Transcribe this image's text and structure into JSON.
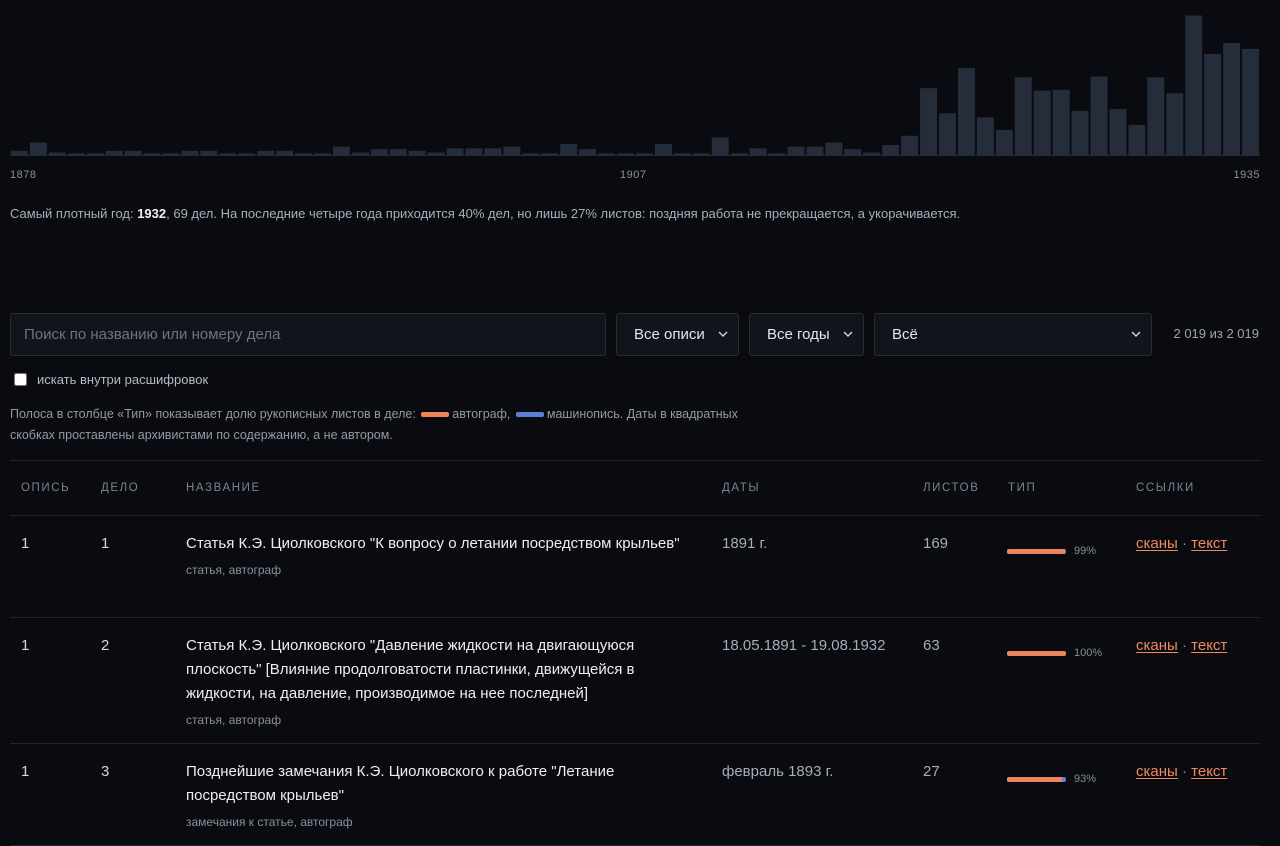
{
  "histogram": {
    "start_label": "1878",
    "mid_label": "1907",
    "end_label": "1935",
    "bar_color": "#262d3a",
    "chart_data": {
      "type": "bar",
      "x_start": 1878,
      "x_end": 1935,
      "values": [
        0.5,
        1.5,
        0.3,
        0.2,
        0.2,
        0.5,
        0.5,
        0.2,
        0.2,
        0.5,
        0.5,
        0.2,
        0.2,
        0.5,
        0.5,
        0.2,
        0.2,
        1,
        0.3,
        0.7,
        0.7,
        0.5,
        0.3,
        0.8,
        0.8,
        0.8,
        1,
        0.2,
        0.2,
        1.3,
        0.7,
        0.2,
        0.2,
        0.2,
        1.3,
        0.2,
        0.2,
        2.1,
        0.2,
        0.8,
        0.2,
        1,
        1,
        1.5,
        0.7,
        0.3,
        1.2,
        2.3,
        8,
        5,
        10.4,
        4.5,
        3,
        9.3,
        7.7,
        7.8,
        5.3,
        9.4,
        5.5,
        3.6,
        9.3,
        7.4,
        16.7,
        12.1,
        13.4,
        12.7
      ],
      "ylim": [
        0,
        17
      ]
    }
  },
  "summary": {
    "prefix": "Самый плотный год: ",
    "year": "1932",
    "rest": ", 69 дел. На последние четыре года приходится 40% дел, но лишь 27% листов: поздняя работа не прекращается, а укорачивается."
  },
  "filters": {
    "search_placeholder": "Поиск по названию или номеру дела",
    "opisi": "Все описи",
    "years": "Все годы",
    "type": "Всё",
    "count": "2 019 из 2 019",
    "checkbox_label": "искать внутри расшифровок"
  },
  "legend": {
    "part1": "Полоса в столбце «Тип» показывает долю рукописных листов в деле: ",
    "autograph": "автограф,",
    "typescript": "машинопись.",
    "part2": " Даты в квадратных скобках проставлены архивистами по содержанию, а не автором.",
    "autograph_color": "#ee8459",
    "typescript_color": "#5b7fd4"
  },
  "table": {
    "headers": {
      "opis": "ОПИСЬ",
      "delo": "ДЕЛО",
      "name": "НАЗВАНИЕ",
      "dates": "ДАТЫ",
      "sheets": "ЛИСТОВ",
      "type": "ТИП",
      "links": "ССЫЛКИ"
    },
    "rows": [
      {
        "opis": "1",
        "delo": "1",
        "title": "Статья К.Э. Циолковского \"К вопросу о летании посредством крыльев\"",
        "subtitle": "статья, автограф",
        "dates": "1891 г.",
        "sheets": "169",
        "autograph_share": 99,
        "pct": "99%",
        "link_scans": "сканы",
        "link_text": "текст"
      },
      {
        "opis": "1",
        "delo": "2",
        "title": "Статья К.Э. Циолковского \"Давление жидкости на двигающуюся плоскость\" [Влияние продолговатости пластинки, движущейся в жидкости, на давление, производимое на нее последней]",
        "subtitle": "статья, автограф",
        "dates": "18.05.1891 - 19.08.1932",
        "sheets": "63",
        "autograph_share": 100,
        "pct": "100%",
        "link_scans": "сканы",
        "link_text": "текст"
      },
      {
        "opis": "1",
        "delo": "3",
        "title": "Позднейшие замечания К.Э. Циолковского к работе \"Летание посредством крыльев\"",
        "subtitle": "замечания к статье, автограф",
        "dates": "февраль 1893 г.",
        "sheets": "27",
        "autograph_share": 93,
        "pct": "93%",
        "link_scans": "сканы",
        "link_text": "текст"
      }
    ]
  }
}
